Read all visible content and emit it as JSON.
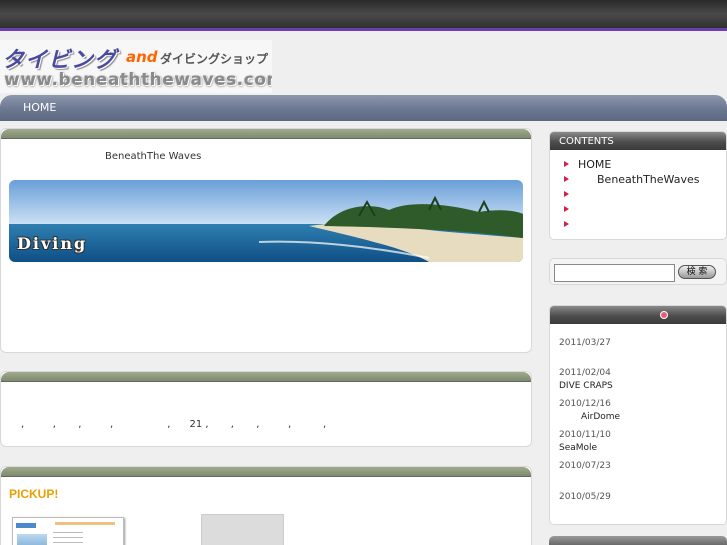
{
  "logo": {
    "main": "タイビング",
    "and": "and",
    "sub": "ダイビングショップ",
    "url": "www.beneaththewaves.com"
  },
  "nav": {
    "home": "HOME"
  },
  "main": {
    "panel1_title": "BeneathThe Waves",
    "banner_text": "Diving",
    "panel2_text": ",         ,       ,         ,                 ,      21 ,       ,       ,         ,          ,",
    "pickup_title": "PICKUP!"
  },
  "sidebar": {
    "contents_title": "CONTENTS",
    "items": [
      {
        "label": "HOME",
        "indent": false
      },
      {
        "label": "BeneathTheWaves",
        "indent": true
      },
      {
        "label": "",
        "indent": false
      },
      {
        "label": "",
        "indent": false
      },
      {
        "label": "",
        "indent": false
      }
    ],
    "search": {
      "value": "",
      "button": "検 索"
    },
    "news": [
      {
        "date": "2011/03/27",
        "title": ""
      },
      {
        "date": "2011/02/04",
        "title": "DIVE CRAPS"
      },
      {
        "date": "2010/12/16",
        "title": "AirDome",
        "indent": true
      },
      {
        "date": "2010/11/10",
        "title": "SeaMole"
      },
      {
        "date": "2010/07/23",
        "title": ""
      },
      {
        "date": "2010/05/29",
        "title": ""
      }
    ]
  },
  "colors": {
    "accent_line": "#6a3fb0",
    "nav_bg": "#6e7a94",
    "pickup": "#e8a000",
    "bullet": "#d0204a"
  }
}
